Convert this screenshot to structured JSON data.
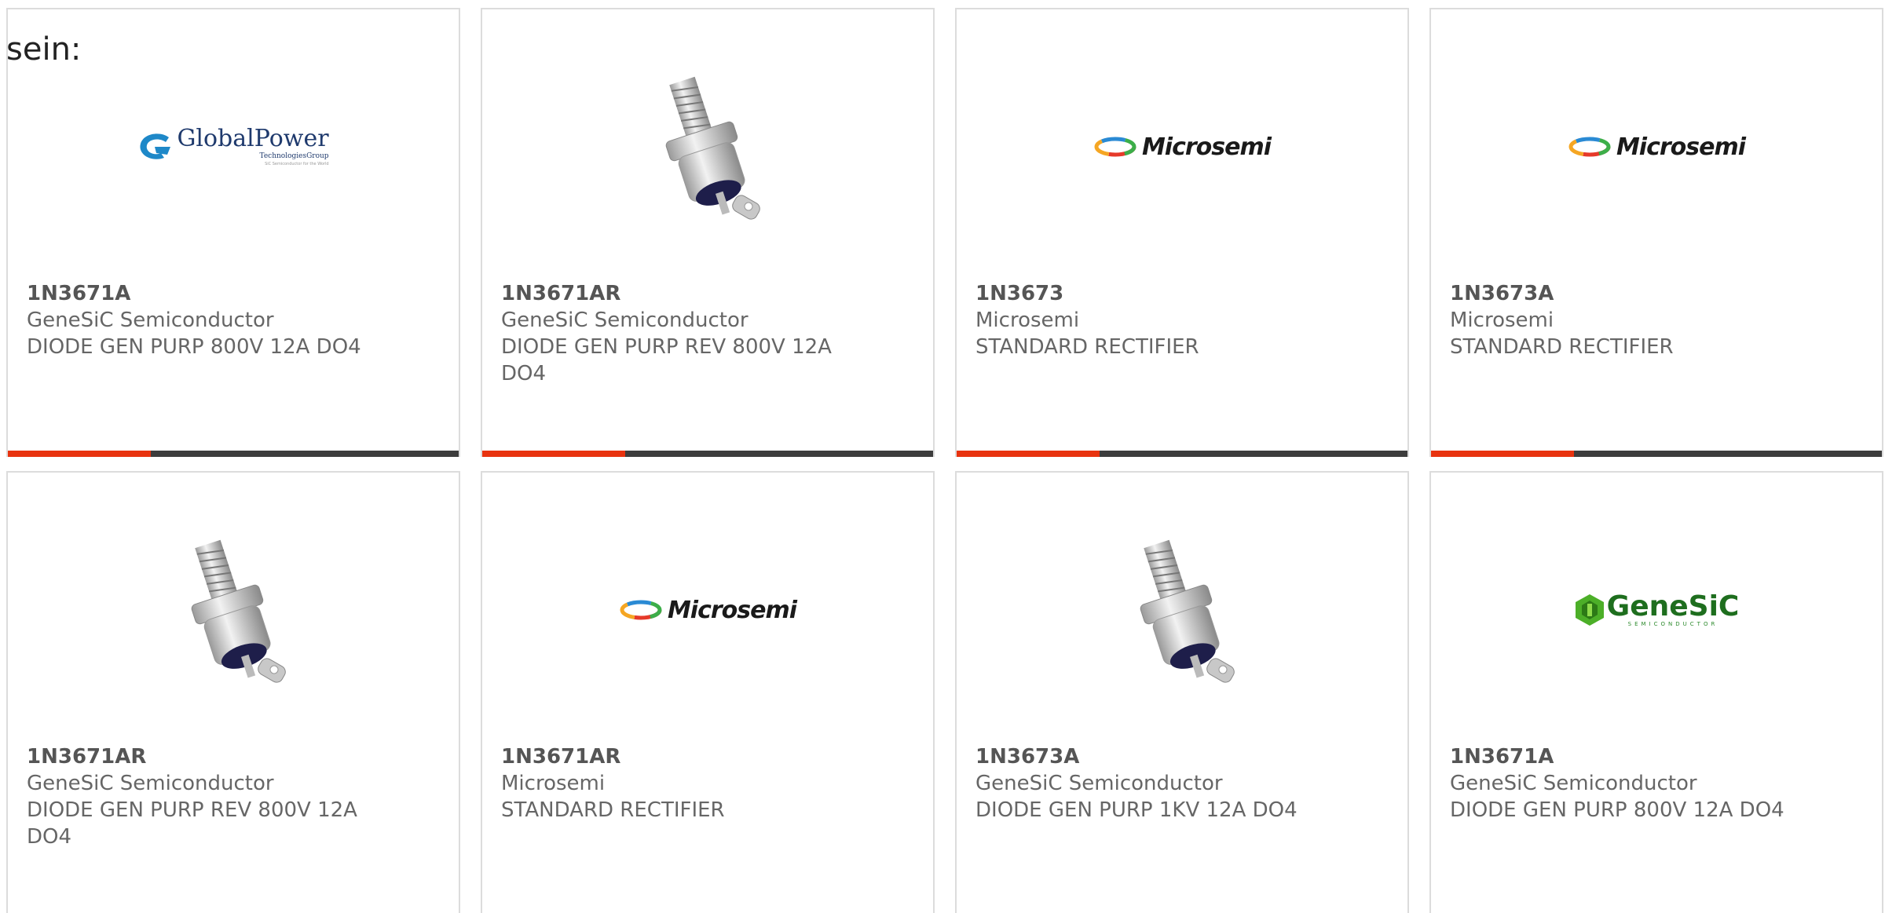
{
  "heading": "sein:",
  "logos": {
    "globalpower": {
      "name": "GlobalPower",
      "sub": "TechnologiesGroup",
      "tagline": "SiC Semiconductor for the World"
    },
    "microsemi": {
      "name": "Microsemi"
    },
    "genesic": {
      "name": "GeneSiC",
      "sub": "SEMICONDUCTOR"
    }
  },
  "colors": {
    "accent": "#e8330f",
    "bar": "#3d3d3d",
    "border": "#dcdcdc",
    "text": "#666666"
  },
  "cards": [
    {
      "part": "1N3671A",
      "maker": "GeneSiC Semiconductor",
      "desc": "DIODE GEN PURP 800V 12A DO4",
      "image": "globalpower-logo"
    },
    {
      "part": "1N3671AR",
      "maker": "GeneSiC Semiconductor",
      "desc": "DIODE GEN PURP REV 800V 12A DO4",
      "image": "stud-diode-photo"
    },
    {
      "part": "1N3673",
      "maker": "Microsemi",
      "desc": "STANDARD RECTIFIER",
      "image": "microsemi-logo"
    },
    {
      "part": "1N3673A",
      "maker": "Microsemi",
      "desc": "STANDARD RECTIFIER",
      "image": "microsemi-logo"
    },
    {
      "part": "1N3671AR",
      "maker": "GeneSiC Semiconductor",
      "desc": "DIODE GEN PURP REV 800V 12A DO4",
      "image": "stud-diode-photo"
    },
    {
      "part": "1N3671AR",
      "maker": "Microsemi",
      "desc": "STANDARD RECTIFIER",
      "image": "microsemi-logo"
    },
    {
      "part": "1N3673A",
      "maker": "GeneSiC Semiconductor",
      "desc": "DIODE GEN PURP 1KV 12A DO4",
      "image": "stud-diode-photo"
    },
    {
      "part": "1N3671A",
      "maker": "GeneSiC Semiconductor",
      "desc": "DIODE GEN PURP 800V 12A DO4",
      "image": "genesic-logo"
    }
  ]
}
